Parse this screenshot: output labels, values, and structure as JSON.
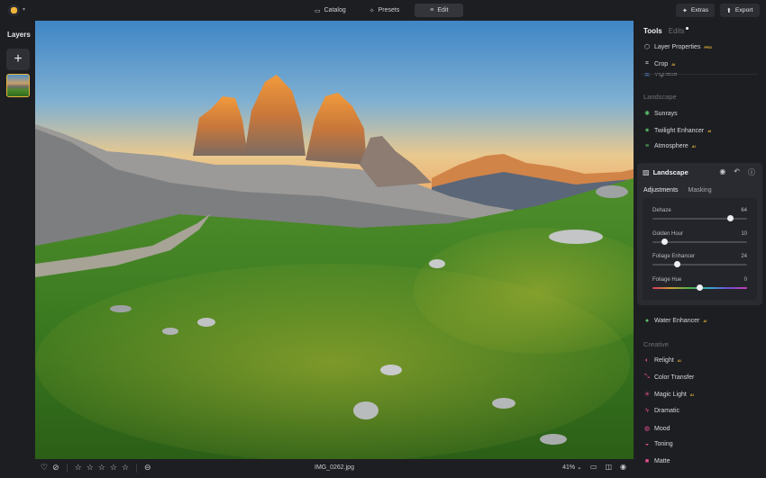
{
  "topbar": {
    "tabs": [
      {
        "label": "Catalog",
        "icon": "folder-icon"
      },
      {
        "label": "Presets",
        "icon": "sparkle-icon"
      },
      {
        "label": "Edit",
        "icon": "sliders-icon",
        "active": true
      }
    ],
    "extras_label": "Extras",
    "export_label": "Export"
  },
  "left_panel": {
    "title": "Layers"
  },
  "bottom_bar": {
    "filename": "IMG_0262.jpg",
    "zoom": "41%",
    "rating_stars": 5
  },
  "right_panel": {
    "tabs": [
      {
        "label": "Tools",
        "active": true
      },
      {
        "label": "Edits",
        "active": false
      }
    ],
    "top_tools": [
      {
        "label": "Layer Properties",
        "badge": "PRO",
        "icon": "layers-icon"
      },
      {
        "label": "Crop",
        "badge": "AI",
        "icon": "crop-icon"
      },
      {
        "label": "Vignette",
        "icon": "vignette-icon"
      }
    ],
    "landscape_section": "Landscape",
    "landscape_tools": [
      {
        "label": "Sunrays",
        "icon": "sun-icon"
      },
      {
        "label": "Twilight Enhancer",
        "badge": "AI",
        "icon": "twilight-icon"
      },
      {
        "label": "Atmosphere",
        "badge": "AI",
        "icon": "atmosphere-icon"
      }
    ],
    "landscape_card": {
      "title": "Landscape",
      "subtabs": [
        "Adjustments",
        "Masking"
      ],
      "sliders": [
        {
          "label": "Dehaze",
          "value": "64",
          "fraction": 0.82
        },
        {
          "label": "Golden Hour",
          "value": "10",
          "fraction": 0.13
        },
        {
          "label": "Foliage Enhancer",
          "value": "24",
          "fraction": 0.26
        },
        {
          "label": "Foliage Hue",
          "value": "0",
          "fraction": 0.5
        }
      ]
    },
    "water_tool": {
      "label": "Water Enhancer",
      "badge": "AI",
      "icon": "drop-icon"
    },
    "creative_section": "Creative",
    "creative_tools": [
      {
        "label": "Relight",
        "badge": "AI",
        "icon": "relight-icon"
      },
      {
        "label": "Color Transfer",
        "icon": "color-transfer-icon"
      },
      {
        "label": "Magic Light",
        "badge": "AI",
        "icon": "magic-light-icon"
      },
      {
        "label": "Dramatic",
        "icon": "dramatic-icon"
      },
      {
        "label": "Mood",
        "icon": "mood-icon"
      },
      {
        "label": "Toning",
        "icon": "toning-icon"
      },
      {
        "label": "Matte",
        "icon": "matte-icon"
      }
    ],
    "accent": "#e8b53b"
  }
}
